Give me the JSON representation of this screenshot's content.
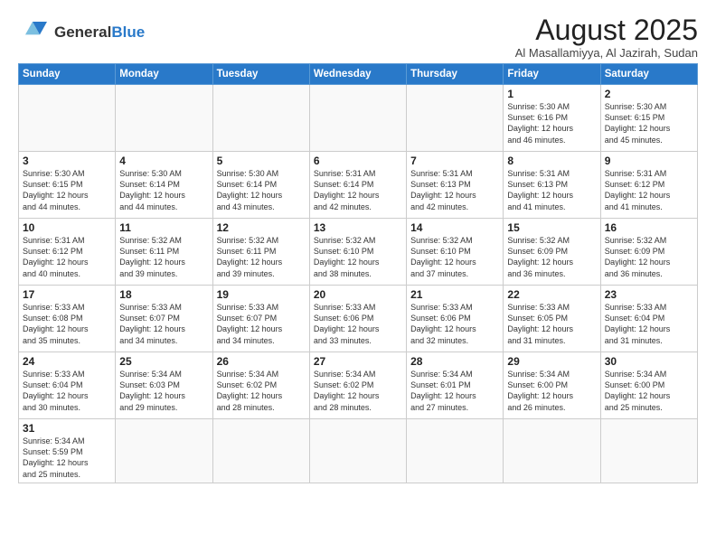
{
  "header": {
    "logo_general": "General",
    "logo_blue": "Blue",
    "main_title": "August 2025",
    "subtitle": "Al Masallamiyya, Al Jazirah, Sudan"
  },
  "columns": [
    "Sunday",
    "Monday",
    "Tuesday",
    "Wednesday",
    "Thursday",
    "Friday",
    "Saturday"
  ],
  "weeks": [
    {
      "days": [
        {
          "num": "",
          "info": ""
        },
        {
          "num": "",
          "info": ""
        },
        {
          "num": "",
          "info": ""
        },
        {
          "num": "",
          "info": ""
        },
        {
          "num": "",
          "info": ""
        },
        {
          "num": "1",
          "info": "Sunrise: 5:30 AM\nSunset: 6:16 PM\nDaylight: 12 hours\nand 46 minutes."
        },
        {
          "num": "2",
          "info": "Sunrise: 5:30 AM\nSunset: 6:15 PM\nDaylight: 12 hours\nand 45 minutes."
        }
      ]
    },
    {
      "days": [
        {
          "num": "3",
          "info": "Sunrise: 5:30 AM\nSunset: 6:15 PM\nDaylight: 12 hours\nand 44 minutes."
        },
        {
          "num": "4",
          "info": "Sunrise: 5:30 AM\nSunset: 6:14 PM\nDaylight: 12 hours\nand 44 minutes."
        },
        {
          "num": "5",
          "info": "Sunrise: 5:30 AM\nSunset: 6:14 PM\nDaylight: 12 hours\nand 43 minutes."
        },
        {
          "num": "6",
          "info": "Sunrise: 5:31 AM\nSunset: 6:14 PM\nDaylight: 12 hours\nand 42 minutes."
        },
        {
          "num": "7",
          "info": "Sunrise: 5:31 AM\nSunset: 6:13 PM\nDaylight: 12 hours\nand 42 minutes."
        },
        {
          "num": "8",
          "info": "Sunrise: 5:31 AM\nSunset: 6:13 PM\nDaylight: 12 hours\nand 41 minutes."
        },
        {
          "num": "9",
          "info": "Sunrise: 5:31 AM\nSunset: 6:12 PM\nDaylight: 12 hours\nand 41 minutes."
        }
      ]
    },
    {
      "days": [
        {
          "num": "10",
          "info": "Sunrise: 5:31 AM\nSunset: 6:12 PM\nDaylight: 12 hours\nand 40 minutes."
        },
        {
          "num": "11",
          "info": "Sunrise: 5:32 AM\nSunset: 6:11 PM\nDaylight: 12 hours\nand 39 minutes."
        },
        {
          "num": "12",
          "info": "Sunrise: 5:32 AM\nSunset: 6:11 PM\nDaylight: 12 hours\nand 39 minutes."
        },
        {
          "num": "13",
          "info": "Sunrise: 5:32 AM\nSunset: 6:10 PM\nDaylight: 12 hours\nand 38 minutes."
        },
        {
          "num": "14",
          "info": "Sunrise: 5:32 AM\nSunset: 6:10 PM\nDaylight: 12 hours\nand 37 minutes."
        },
        {
          "num": "15",
          "info": "Sunrise: 5:32 AM\nSunset: 6:09 PM\nDaylight: 12 hours\nand 36 minutes."
        },
        {
          "num": "16",
          "info": "Sunrise: 5:32 AM\nSunset: 6:09 PM\nDaylight: 12 hours\nand 36 minutes."
        }
      ]
    },
    {
      "days": [
        {
          "num": "17",
          "info": "Sunrise: 5:33 AM\nSunset: 6:08 PM\nDaylight: 12 hours\nand 35 minutes."
        },
        {
          "num": "18",
          "info": "Sunrise: 5:33 AM\nSunset: 6:07 PM\nDaylight: 12 hours\nand 34 minutes."
        },
        {
          "num": "19",
          "info": "Sunrise: 5:33 AM\nSunset: 6:07 PM\nDaylight: 12 hours\nand 34 minutes."
        },
        {
          "num": "20",
          "info": "Sunrise: 5:33 AM\nSunset: 6:06 PM\nDaylight: 12 hours\nand 33 minutes."
        },
        {
          "num": "21",
          "info": "Sunrise: 5:33 AM\nSunset: 6:06 PM\nDaylight: 12 hours\nand 32 minutes."
        },
        {
          "num": "22",
          "info": "Sunrise: 5:33 AM\nSunset: 6:05 PM\nDaylight: 12 hours\nand 31 minutes."
        },
        {
          "num": "23",
          "info": "Sunrise: 5:33 AM\nSunset: 6:04 PM\nDaylight: 12 hours\nand 31 minutes."
        }
      ]
    },
    {
      "days": [
        {
          "num": "24",
          "info": "Sunrise: 5:33 AM\nSunset: 6:04 PM\nDaylight: 12 hours\nand 30 minutes."
        },
        {
          "num": "25",
          "info": "Sunrise: 5:34 AM\nSunset: 6:03 PM\nDaylight: 12 hours\nand 29 minutes."
        },
        {
          "num": "26",
          "info": "Sunrise: 5:34 AM\nSunset: 6:02 PM\nDaylight: 12 hours\nand 28 minutes."
        },
        {
          "num": "27",
          "info": "Sunrise: 5:34 AM\nSunset: 6:02 PM\nDaylight: 12 hours\nand 28 minutes."
        },
        {
          "num": "28",
          "info": "Sunrise: 5:34 AM\nSunset: 6:01 PM\nDaylight: 12 hours\nand 27 minutes."
        },
        {
          "num": "29",
          "info": "Sunrise: 5:34 AM\nSunset: 6:00 PM\nDaylight: 12 hours\nand 26 minutes."
        },
        {
          "num": "30",
          "info": "Sunrise: 5:34 AM\nSunset: 6:00 PM\nDaylight: 12 hours\nand 25 minutes."
        }
      ]
    },
    {
      "days": [
        {
          "num": "31",
          "info": "Sunrise: 5:34 AM\nSunset: 5:59 PM\nDaylight: 12 hours\nand 25 minutes."
        },
        {
          "num": "",
          "info": ""
        },
        {
          "num": "",
          "info": ""
        },
        {
          "num": "",
          "info": ""
        },
        {
          "num": "",
          "info": ""
        },
        {
          "num": "",
          "info": ""
        },
        {
          "num": "",
          "info": ""
        }
      ]
    }
  ]
}
